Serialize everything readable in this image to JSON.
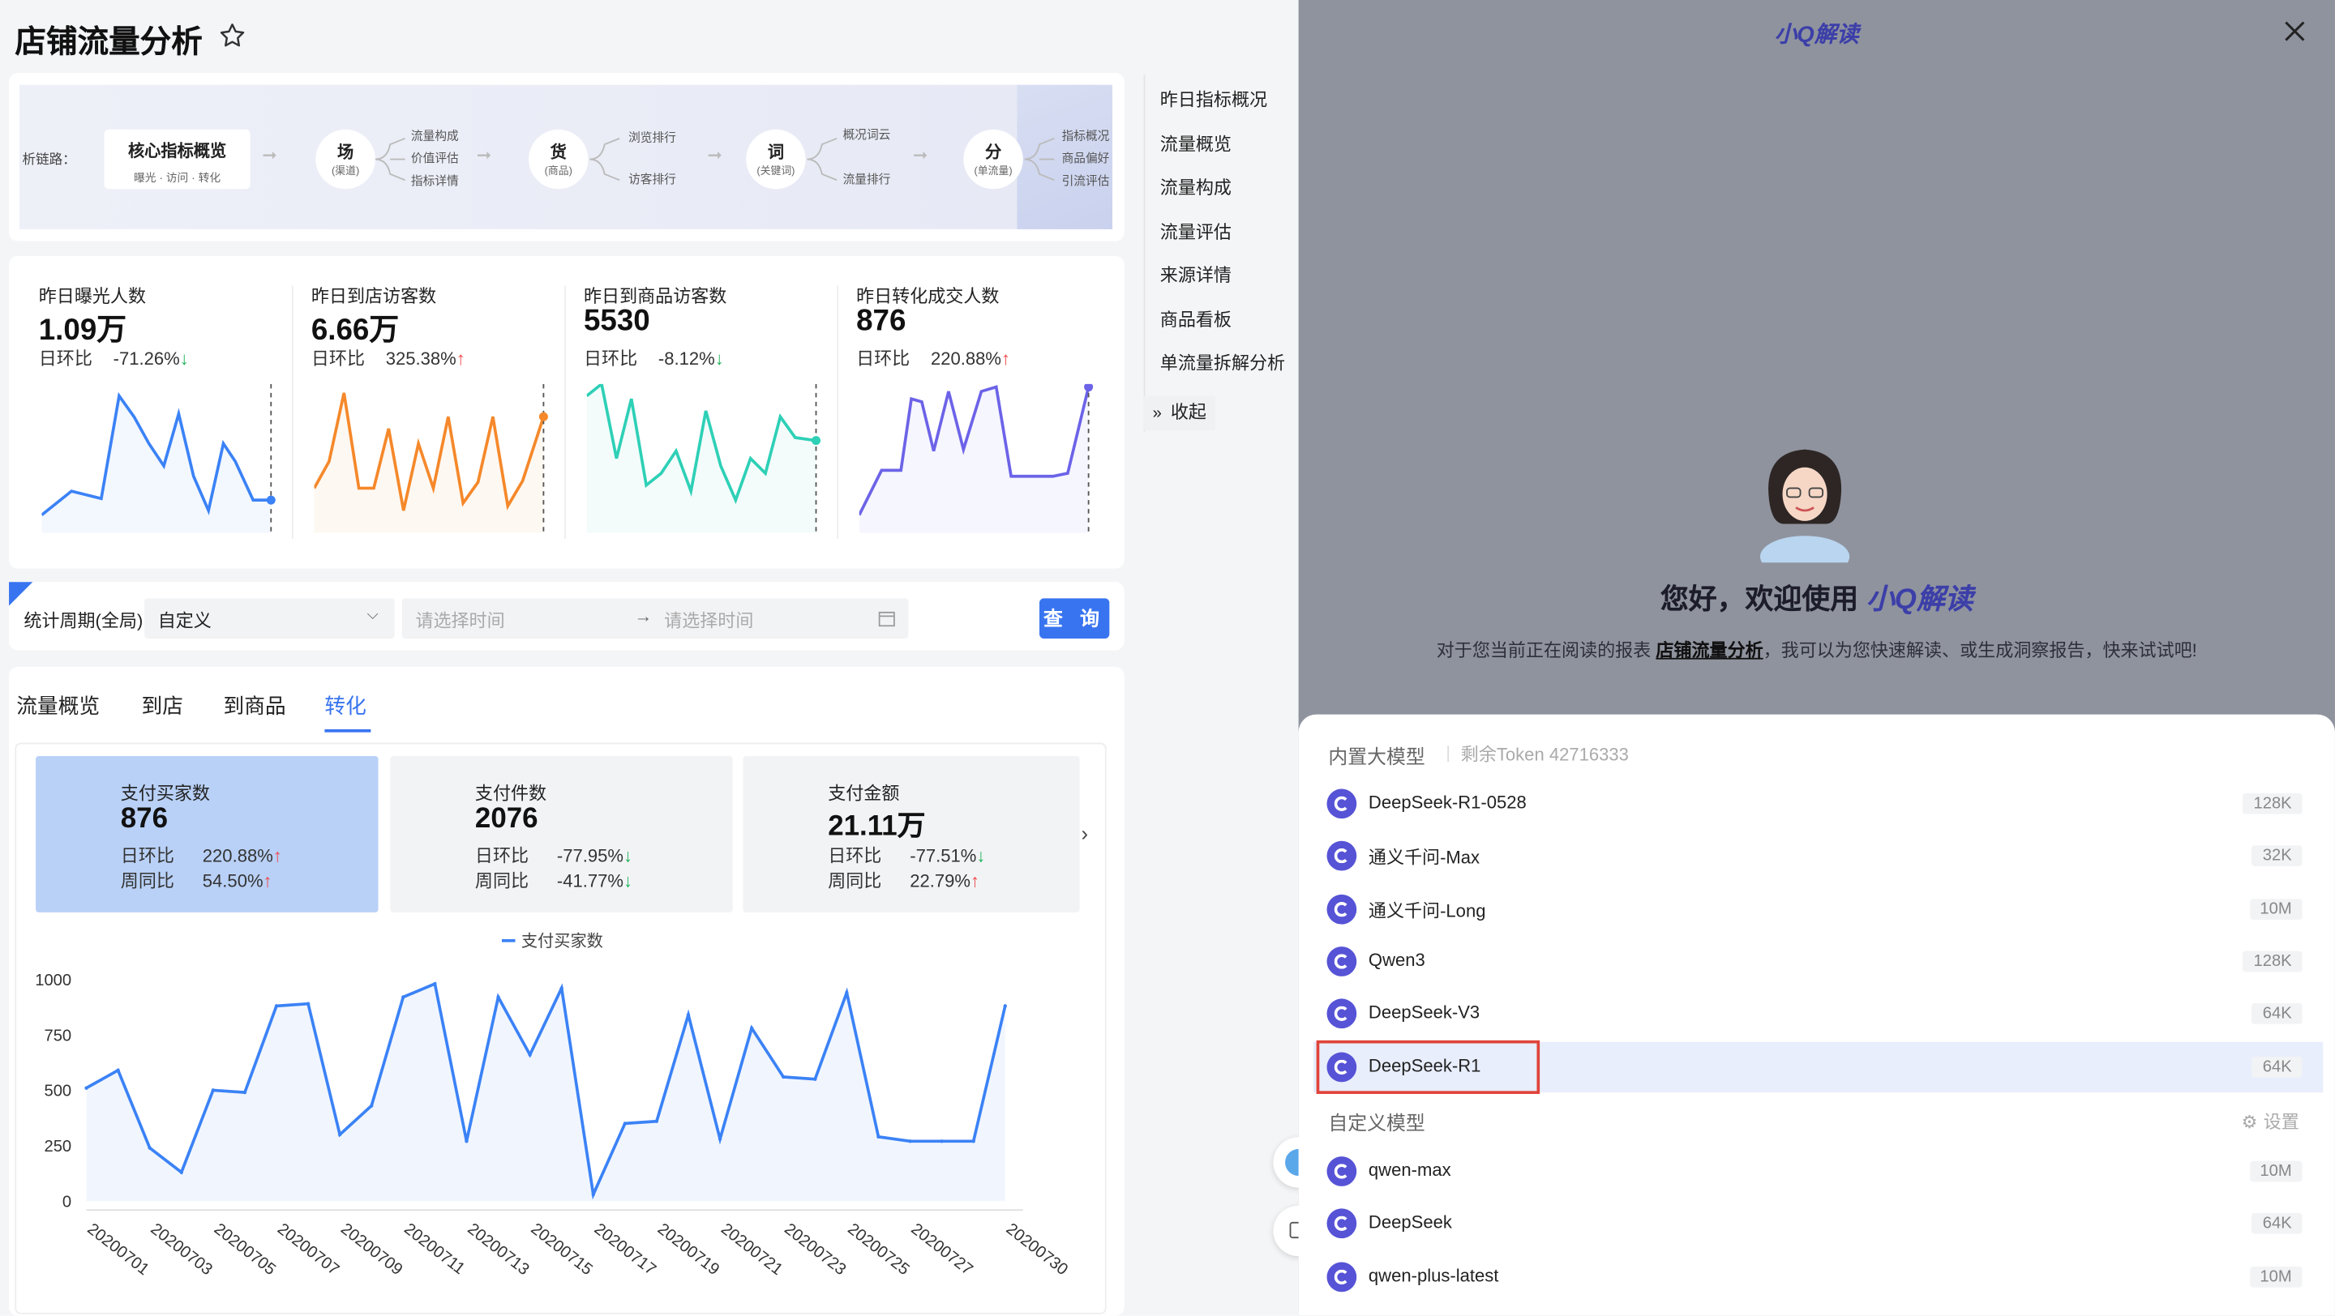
{
  "page": {
    "title": "店铺流量分析",
    "star_icon": "star-icon"
  },
  "flow": {
    "prefix": "析链路：",
    "core_title": "核心指标概览",
    "core_sub": "曝光 · 访问 · 转化",
    "nodes": [
      {
        "name": "场",
        "sub": "(渠道)",
        "items": [
          "流量构成",
          "价值评估",
          "指标详情"
        ]
      },
      {
        "name": "货",
        "sub": "(商品)",
        "items": [
          "浏览排行",
          "访客排行"
        ]
      },
      {
        "name": "词",
        "sub": "(关键词)",
        "items": [
          "概况词云",
          "流量排行"
        ]
      },
      {
        "name": "分",
        "sub": "(单流量)",
        "items": [
          "指标概况",
          "商品偏好",
          "引流评估"
        ]
      }
    ]
  },
  "metrics": [
    {
      "label": "昨日曝光人数",
      "value": "1.09万",
      "ratio_label": "日环比",
      "ratio": "-71.26%",
      "dir": "down",
      "color": "#3b82f6"
    },
    {
      "label": "昨日到店访客数",
      "value": "6.66万",
      "ratio_label": "日环比",
      "ratio": "325.38%",
      "dir": "up",
      "color": "#f5882a"
    },
    {
      "label": "昨日到商品访客数",
      "value": "5530",
      "ratio_label": "日环比",
      "ratio": "-8.12%",
      "dir": "down",
      "color": "#2ed0b6"
    },
    {
      "label": "昨日转化成交人数",
      "value": "876",
      "ratio_label": "日环比",
      "ratio": "220.88%",
      "dir": "up",
      "color": "#6c63e8"
    }
  ],
  "filter": {
    "label": "统计周期(全局)",
    "period": "自定义",
    "start_placeholder": "请选择时间",
    "end_placeholder": "请选择时间",
    "query": "查 询"
  },
  "tabs": [
    "流量概览",
    "到店",
    "到商品",
    "转化"
  ],
  "active_tab": 3,
  "kpis": [
    {
      "label": "支付买家数",
      "value": "876",
      "r1_label": "日环比",
      "r1": "220.88%",
      "r1_dir": "up",
      "r2_label": "周同比",
      "r2": "54.50%",
      "r2_dir": "up"
    },
    {
      "label": "支付件数",
      "value": "2076",
      "r1_label": "日环比",
      "r1": "-77.95%",
      "r1_dir": "down",
      "r2_label": "周同比",
      "r2": "-41.77%",
      "r2_dir": "down"
    },
    {
      "label": "支付金额",
      "value": "21.11万",
      "r1_label": "日环比",
      "r1": "-77.51%",
      "r1_dir": "down",
      "r2_label": "周同比",
      "r2": "22.79%",
      "r2_dir": "up"
    }
  ],
  "side_nav": [
    "昨日指标概况",
    "流量概览",
    "流量构成",
    "流量评估",
    "来源详情",
    "商品看板",
    "单流量拆解分析"
  ],
  "collapse_label": "收起",
  "assistant": {
    "title": "小Q解读",
    "greeting_prefix": "您好，欢迎使用",
    "greeting_brand": "小Q解读",
    "desc_prefix": "对于您当前正在阅读的报表",
    "desc_link": "店铺流量分析",
    "desc_suffix": "，我可以为您快速解读、或生成洞察报告，快来试试吧!",
    "builtin_label": "内置大模型",
    "token_label": "剩余Token 42716333",
    "custom_label": "自定义模型",
    "settings_label": "设置",
    "builtin_models": [
      {
        "name": "DeepSeek-R1-0528",
        "ctx": "128K"
      },
      {
        "name": "通义千问-Max",
        "ctx": "32K"
      },
      {
        "name": "通义千问-Long",
        "ctx": "10M"
      },
      {
        "name": "Qwen3",
        "ctx": "128K"
      },
      {
        "name": "DeepSeek-V3",
        "ctx": "64K"
      },
      {
        "name": "DeepSeek-R1",
        "ctx": "64K"
      }
    ],
    "custom_models": [
      {
        "name": "qwen-max",
        "ctx": "10M"
      },
      {
        "name": "DeepSeek",
        "ctx": "64K"
      },
      {
        "name": "qwen-plus-latest",
        "ctx": "10M"
      }
    ],
    "selected_model": "DeepSeek-R1"
  },
  "chart_data": {
    "type": "area",
    "legend": "支付买家数",
    "x": [
      "20200701",
      "20200702",
      "20200703",
      "20200704",
      "20200705",
      "20200706",
      "20200707",
      "20200708",
      "20200709",
      "20200710",
      "20200711",
      "20200712",
      "20200713",
      "20200714",
      "20200715",
      "20200716",
      "20200717",
      "20200718",
      "20200719",
      "20200720",
      "20200721",
      "20200722",
      "20200723",
      "20200724",
      "20200725",
      "20200726",
      "20200727",
      "20200728",
      "20200729",
      "20200730"
    ],
    "x_tick_labels": [
      "20200701",
      "20200703",
      "20200705",
      "20200707",
      "20200709",
      "20200711",
      "20200713",
      "20200715",
      "20200717",
      "20200719",
      "20200721",
      "20200723",
      "20200725",
      "20200727",
      "20200730"
    ],
    "values": [
      510,
      590,
      240,
      130,
      500,
      490,
      880,
      890,
      300,
      430,
      920,
      980,
      270,
      920,
      660,
      960,
      30,
      350,
      360,
      840,
      280,
      780,
      560,
      550,
      940,
      290,
      270,
      270,
      270,
      880
    ],
    "yticks": [
      0,
      250,
      500,
      750,
      1000
    ],
    "ylim": [
      0,
      1000
    ],
    "color": "#3b82f6"
  }
}
